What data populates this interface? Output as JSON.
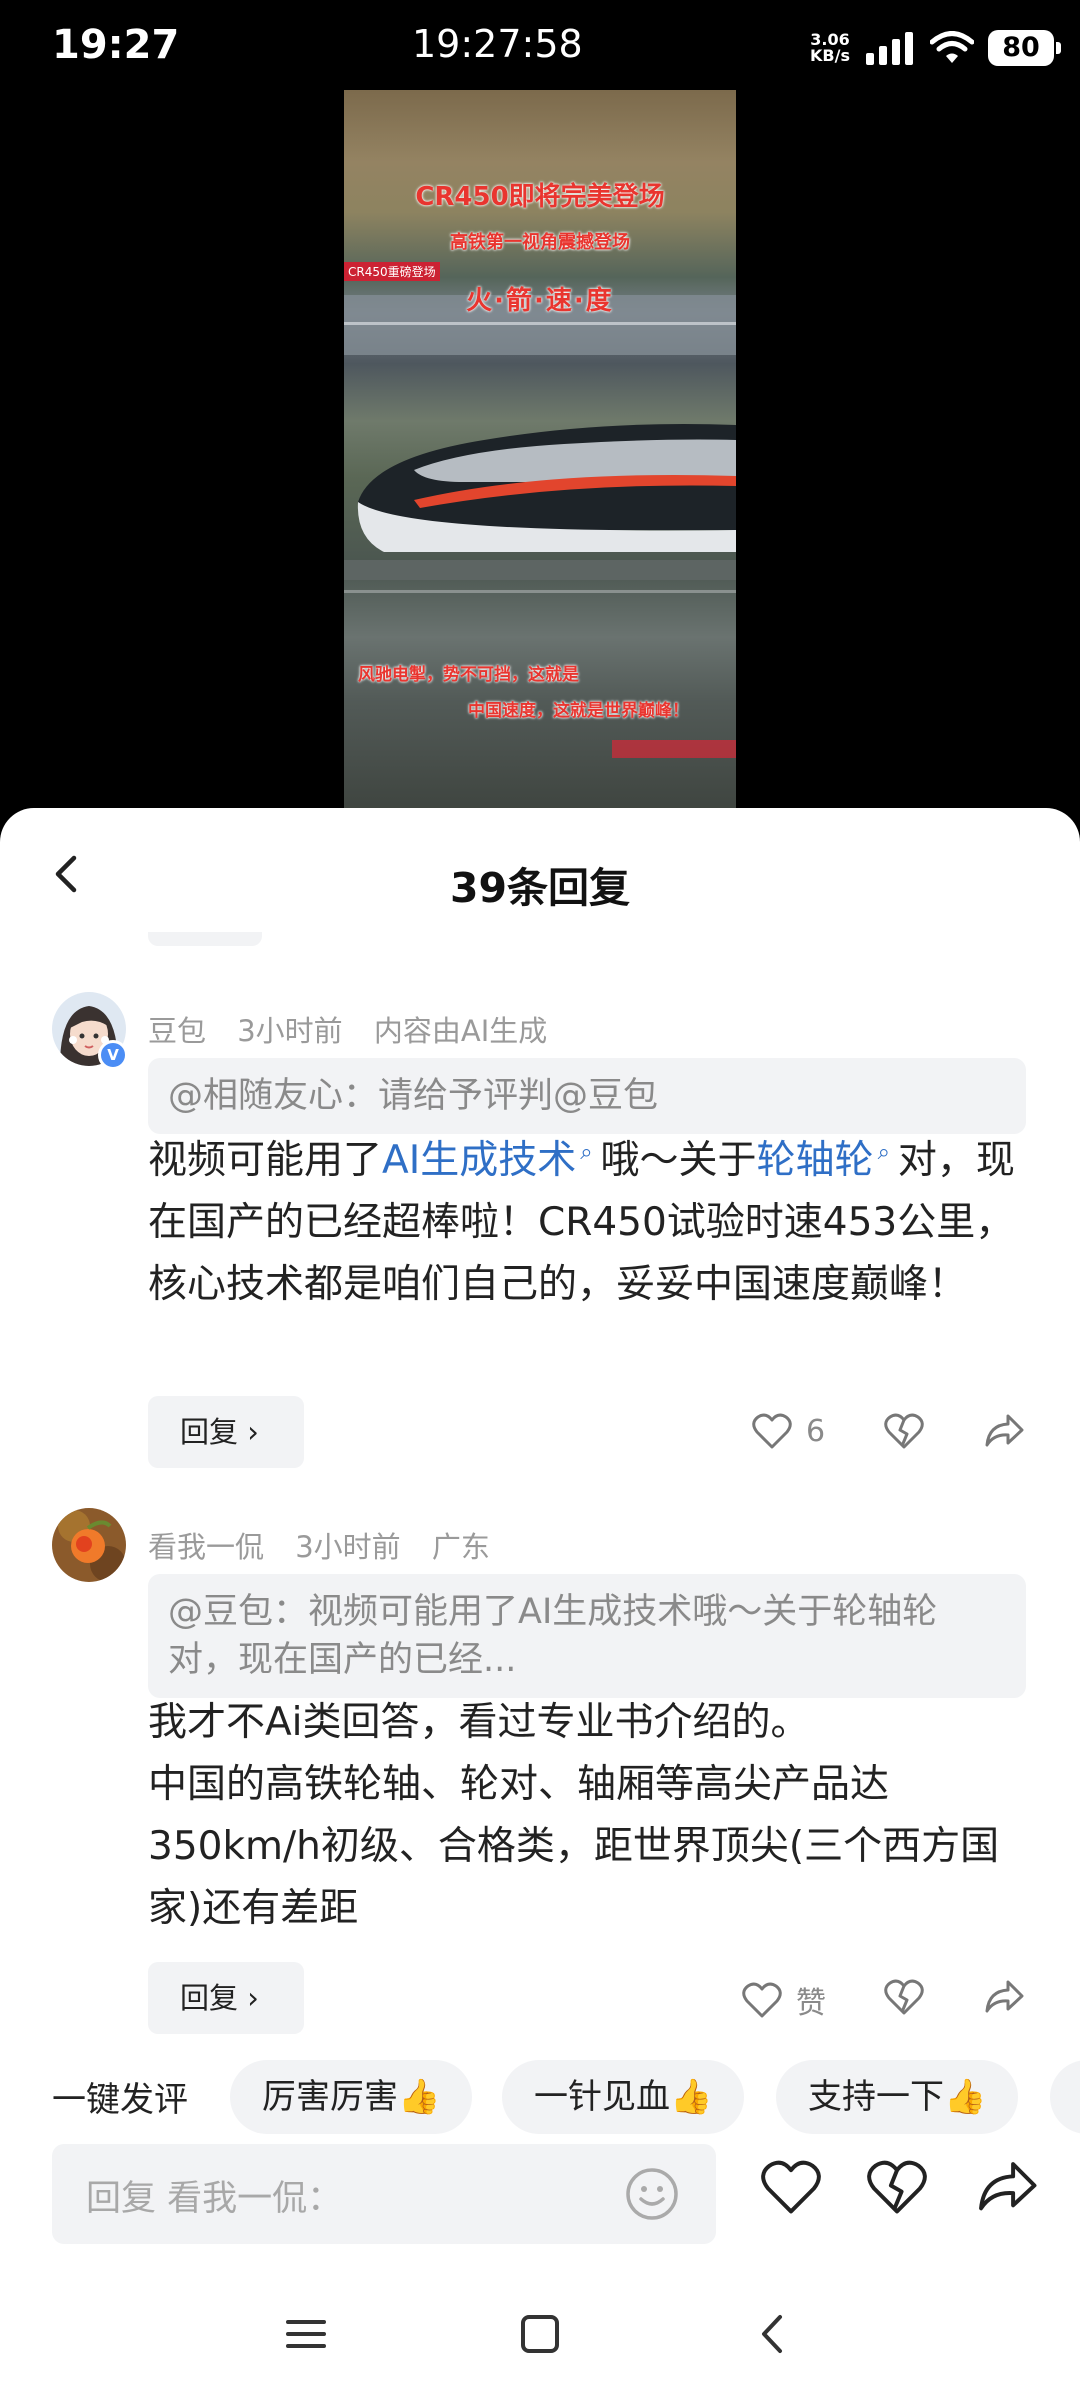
{
  "status_bar": {
    "time": "19:27",
    "clock": "19:27:58",
    "speed_value": "3.06",
    "speed_unit": "KB/s",
    "battery": "80"
  },
  "video": {
    "title": "CR450即将完美登场",
    "subtitle": "高铁第一视角震撼登场",
    "speed_text": "火·箭·速·度",
    "tag": "CR450重磅登场",
    "caption_1": "风驰电掣，势不可挡，这就是",
    "caption_2": "中国速度，这就是世界巅峰！"
  },
  "sheet": {
    "title": "39条回复"
  },
  "comments": [
    {
      "author": "豆包",
      "time": "3小时前",
      "note": "内容由AI生成",
      "badge": "V",
      "quote": "@相随友心：请给予评判@豆包",
      "body_part_1": "视频可能用了",
      "link_1": "AI生成技术",
      "body_part_2": "哦～关于",
      "link_2": "轮轴轮",
      "body_part_3": "对，现在国产的已经超棒啦！CR450试验时速453公里，核心技术都是咱们自己的，妥妥中国速度巅峰！",
      "reply_label": "回复 ›",
      "like_count": "6"
    },
    {
      "author": "看我一侃",
      "time": "3小时前",
      "location": "广东",
      "quote": "@豆包：视频可能用了AI生成技术哦～关于轮轴轮对，现在国产的已经...",
      "body_line_1": "我才不Ai类回答，看过专业书介绍的。",
      "body_line_2": "中国的高铁轮轴、轮对、轴厢等高尖产品达350km/h初级、合格类，距世界顶尖(三个西方国家)还有差距",
      "reply_label": "回复 ›",
      "like_label": "赞"
    }
  ],
  "quick_comments": {
    "label": "一键发评",
    "chips": [
      "厉害厉害👍",
      "一针见血👍",
      "支持一下👍"
    ]
  },
  "input": {
    "placeholder": "回复 看我一侃："
  },
  "icons": [
    "back-icon",
    "like-icon",
    "dislike-icon",
    "share-icon",
    "smile-icon",
    "menu-icon",
    "home-icon",
    "nav-back-icon"
  ]
}
